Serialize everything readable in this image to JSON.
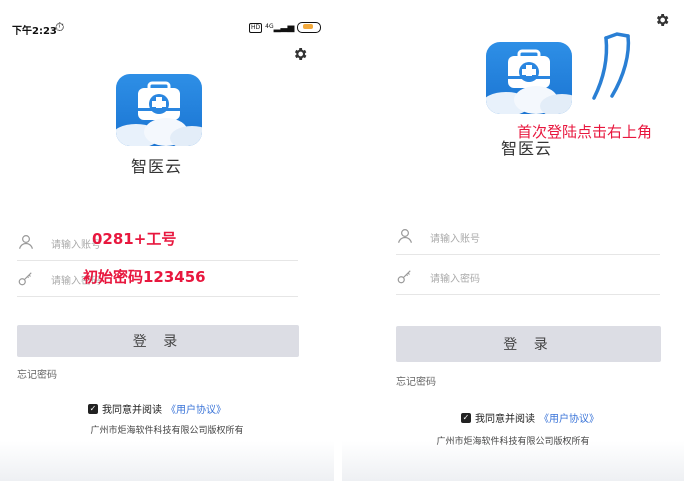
{
  "status_bar": {
    "time": "下午2:23",
    "alarm_icon": "alarm-icon",
    "signal_text": "4G",
    "battery_level": 0.5
  },
  "app": {
    "name": "智医云",
    "logo_icon": "medical-kit-icon"
  },
  "settings_icon": "gear-icon",
  "account_field": {
    "placeholder": "请输入账号",
    "icon": "user-icon"
  },
  "password_field": {
    "placeholder": "请输入密码",
    "icon": "key-icon"
  },
  "login_button": {
    "label": "登 录"
  },
  "forgot_link": {
    "label": "忘记密码"
  },
  "agreement": {
    "prefix": "我同意并阅读",
    "link": "《用户协议》",
    "checked": true
  },
  "copyright": "广州市炬海软件科技有限公司版权所有",
  "annotations": {
    "account_hint": "0281+工号",
    "password_hint": "初始密码123456",
    "settings_hint": "首次登陆点击右上角"
  },
  "colors": {
    "accent_red": "#e8173e",
    "arrow_blue": "#2a7fd4",
    "link_blue": "#3a74d8",
    "button_gray": "#dcdde4"
  }
}
